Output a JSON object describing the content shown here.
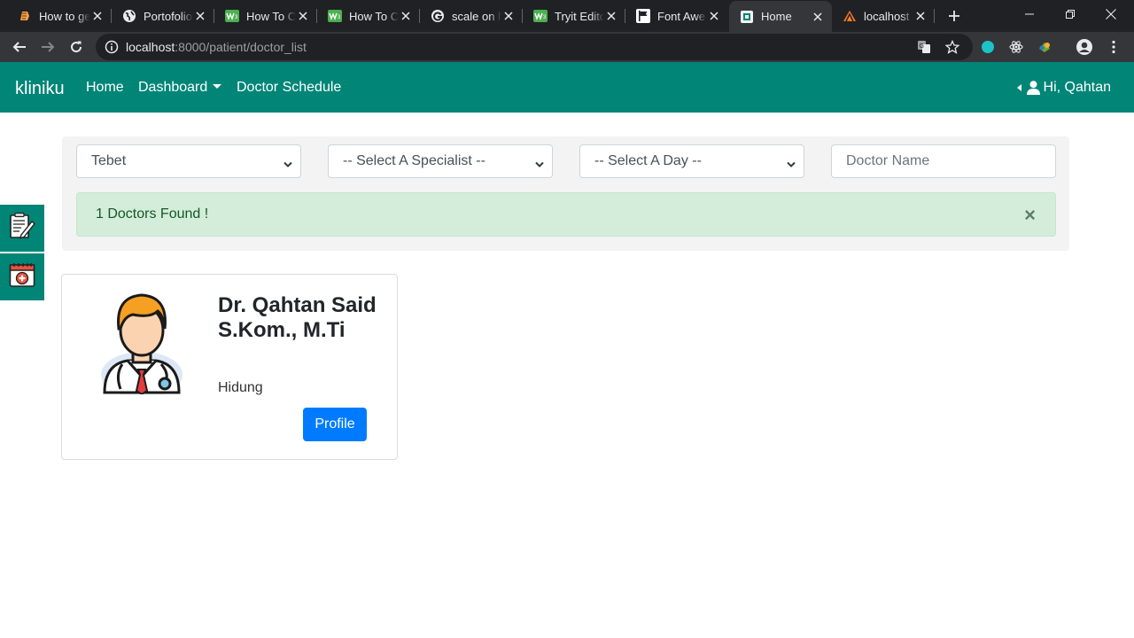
{
  "browser": {
    "tabs": [
      {
        "title": "How to get",
        "icon": "blogger-icon"
      },
      {
        "title": "Portofolio",
        "icon": "globe-icon"
      },
      {
        "title": "How To Cr",
        "icon": "w3schools-icon"
      },
      {
        "title": "How To Cr",
        "icon": "w3schools-icon"
      },
      {
        "title": "scale on h",
        "icon": "google-icon"
      },
      {
        "title": "Tryit Edito",
        "icon": "w3schools-icon"
      },
      {
        "title": "Font Awe",
        "icon": "flag-icon"
      },
      {
        "title": "Home",
        "icon": "page-icon",
        "active": true
      },
      {
        "title": "localhost",
        "icon": "xampp-icon"
      }
    ],
    "url_host": "localhost",
    "url_path": ":8000/patient/doctor_list"
  },
  "navbar": {
    "brand": "kliniku",
    "links": [
      "Home",
      "Dashboard",
      "Doctor Schedule"
    ],
    "user_label": "Hi, Qahtan"
  },
  "filters": {
    "location": "Tebet",
    "specialist": "-- Select A Specialist --",
    "day": "-- Select A Day --",
    "doctor_name_placeholder": "Doctor Name"
  },
  "alert": {
    "message": "1 Doctors Found !",
    "close": "×"
  },
  "doctor": {
    "name": "Dr. Qahtan Said S.Kom., M.Ti",
    "specialty": "Hidung",
    "profile_button": "Profile"
  },
  "colors": {
    "brand_teal": "#008577",
    "alert_bg": "#d4edda",
    "primary_button": "#007bff"
  }
}
